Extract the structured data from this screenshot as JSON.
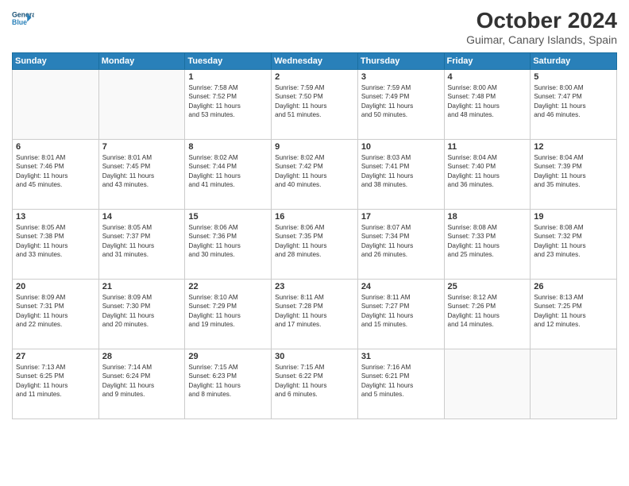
{
  "header": {
    "logo_line1": "General",
    "logo_line2": "Blue",
    "month": "October 2024",
    "location": "Guimar, Canary Islands, Spain"
  },
  "days_of_week": [
    "Sunday",
    "Monday",
    "Tuesday",
    "Wednesday",
    "Thursday",
    "Friday",
    "Saturday"
  ],
  "weeks": [
    [
      {
        "day": "",
        "info": ""
      },
      {
        "day": "",
        "info": ""
      },
      {
        "day": "1",
        "info": "Sunrise: 7:58 AM\nSunset: 7:52 PM\nDaylight: 11 hours\nand 53 minutes."
      },
      {
        "day": "2",
        "info": "Sunrise: 7:59 AM\nSunset: 7:50 PM\nDaylight: 11 hours\nand 51 minutes."
      },
      {
        "day": "3",
        "info": "Sunrise: 7:59 AM\nSunset: 7:49 PM\nDaylight: 11 hours\nand 50 minutes."
      },
      {
        "day": "4",
        "info": "Sunrise: 8:00 AM\nSunset: 7:48 PM\nDaylight: 11 hours\nand 48 minutes."
      },
      {
        "day": "5",
        "info": "Sunrise: 8:00 AM\nSunset: 7:47 PM\nDaylight: 11 hours\nand 46 minutes."
      }
    ],
    [
      {
        "day": "6",
        "info": "Sunrise: 8:01 AM\nSunset: 7:46 PM\nDaylight: 11 hours\nand 45 minutes."
      },
      {
        "day": "7",
        "info": "Sunrise: 8:01 AM\nSunset: 7:45 PM\nDaylight: 11 hours\nand 43 minutes."
      },
      {
        "day": "8",
        "info": "Sunrise: 8:02 AM\nSunset: 7:44 PM\nDaylight: 11 hours\nand 41 minutes."
      },
      {
        "day": "9",
        "info": "Sunrise: 8:02 AM\nSunset: 7:42 PM\nDaylight: 11 hours\nand 40 minutes."
      },
      {
        "day": "10",
        "info": "Sunrise: 8:03 AM\nSunset: 7:41 PM\nDaylight: 11 hours\nand 38 minutes."
      },
      {
        "day": "11",
        "info": "Sunrise: 8:04 AM\nSunset: 7:40 PM\nDaylight: 11 hours\nand 36 minutes."
      },
      {
        "day": "12",
        "info": "Sunrise: 8:04 AM\nSunset: 7:39 PM\nDaylight: 11 hours\nand 35 minutes."
      }
    ],
    [
      {
        "day": "13",
        "info": "Sunrise: 8:05 AM\nSunset: 7:38 PM\nDaylight: 11 hours\nand 33 minutes."
      },
      {
        "day": "14",
        "info": "Sunrise: 8:05 AM\nSunset: 7:37 PM\nDaylight: 11 hours\nand 31 minutes."
      },
      {
        "day": "15",
        "info": "Sunrise: 8:06 AM\nSunset: 7:36 PM\nDaylight: 11 hours\nand 30 minutes."
      },
      {
        "day": "16",
        "info": "Sunrise: 8:06 AM\nSunset: 7:35 PM\nDaylight: 11 hours\nand 28 minutes."
      },
      {
        "day": "17",
        "info": "Sunrise: 8:07 AM\nSunset: 7:34 PM\nDaylight: 11 hours\nand 26 minutes."
      },
      {
        "day": "18",
        "info": "Sunrise: 8:08 AM\nSunset: 7:33 PM\nDaylight: 11 hours\nand 25 minutes."
      },
      {
        "day": "19",
        "info": "Sunrise: 8:08 AM\nSunset: 7:32 PM\nDaylight: 11 hours\nand 23 minutes."
      }
    ],
    [
      {
        "day": "20",
        "info": "Sunrise: 8:09 AM\nSunset: 7:31 PM\nDaylight: 11 hours\nand 22 minutes."
      },
      {
        "day": "21",
        "info": "Sunrise: 8:09 AM\nSunset: 7:30 PM\nDaylight: 11 hours\nand 20 minutes."
      },
      {
        "day": "22",
        "info": "Sunrise: 8:10 AM\nSunset: 7:29 PM\nDaylight: 11 hours\nand 19 minutes."
      },
      {
        "day": "23",
        "info": "Sunrise: 8:11 AM\nSunset: 7:28 PM\nDaylight: 11 hours\nand 17 minutes."
      },
      {
        "day": "24",
        "info": "Sunrise: 8:11 AM\nSunset: 7:27 PM\nDaylight: 11 hours\nand 15 minutes."
      },
      {
        "day": "25",
        "info": "Sunrise: 8:12 AM\nSunset: 7:26 PM\nDaylight: 11 hours\nand 14 minutes."
      },
      {
        "day": "26",
        "info": "Sunrise: 8:13 AM\nSunset: 7:25 PM\nDaylight: 11 hours\nand 12 minutes."
      }
    ],
    [
      {
        "day": "27",
        "info": "Sunrise: 7:13 AM\nSunset: 6:25 PM\nDaylight: 11 hours\nand 11 minutes."
      },
      {
        "day": "28",
        "info": "Sunrise: 7:14 AM\nSunset: 6:24 PM\nDaylight: 11 hours\nand 9 minutes."
      },
      {
        "day": "29",
        "info": "Sunrise: 7:15 AM\nSunset: 6:23 PM\nDaylight: 11 hours\nand 8 minutes."
      },
      {
        "day": "30",
        "info": "Sunrise: 7:15 AM\nSunset: 6:22 PM\nDaylight: 11 hours\nand 6 minutes."
      },
      {
        "day": "31",
        "info": "Sunrise: 7:16 AM\nSunset: 6:21 PM\nDaylight: 11 hours\nand 5 minutes."
      },
      {
        "day": "",
        "info": ""
      },
      {
        "day": "",
        "info": ""
      }
    ]
  ]
}
